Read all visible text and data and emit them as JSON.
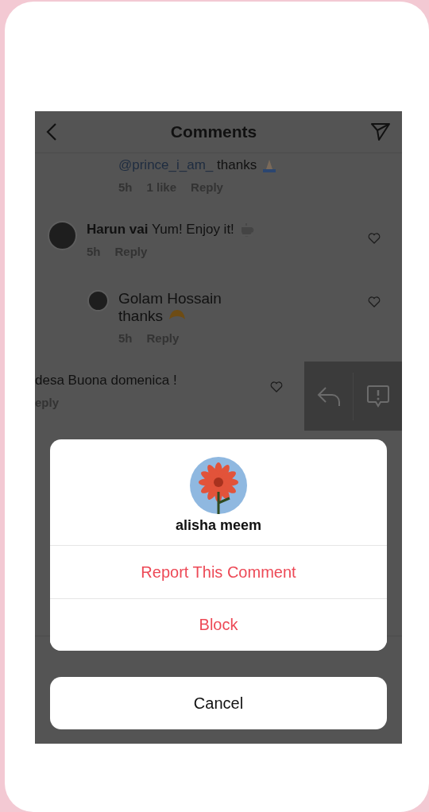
{
  "header": {
    "title": "Comments"
  },
  "comments": [
    {
      "kind": "cut",
      "mention": "@prince_i_am_",
      "text": "thanks",
      "emoji": {
        "kind": "pray"
      },
      "time": "5h",
      "likes": "1 like",
      "reply": "Reply"
    },
    {
      "kind": "comment",
      "author": "Harun vai",
      "text": "Yum! Enjoy it!",
      "emoji": {
        "kind": "coffee"
      },
      "time": "5h",
      "reply": "Reply"
    },
    {
      "kind": "reply",
      "author": "Golam Hossain",
      "text": "thanks",
      "emoji": {
        "kind": "croissant"
      },
      "time": "5h",
      "reply": "Reply"
    },
    {
      "kind": "swiped",
      "text": "desa Buona domenica !",
      "reply": "eply"
    }
  ],
  "sheet": {
    "user": "alisha meem",
    "actions": [
      {
        "label": "Report This Comment",
        "kind": "destructive"
      },
      {
        "label": "Block",
        "kind": "destructive"
      }
    ],
    "cancel": "Cancel"
  }
}
